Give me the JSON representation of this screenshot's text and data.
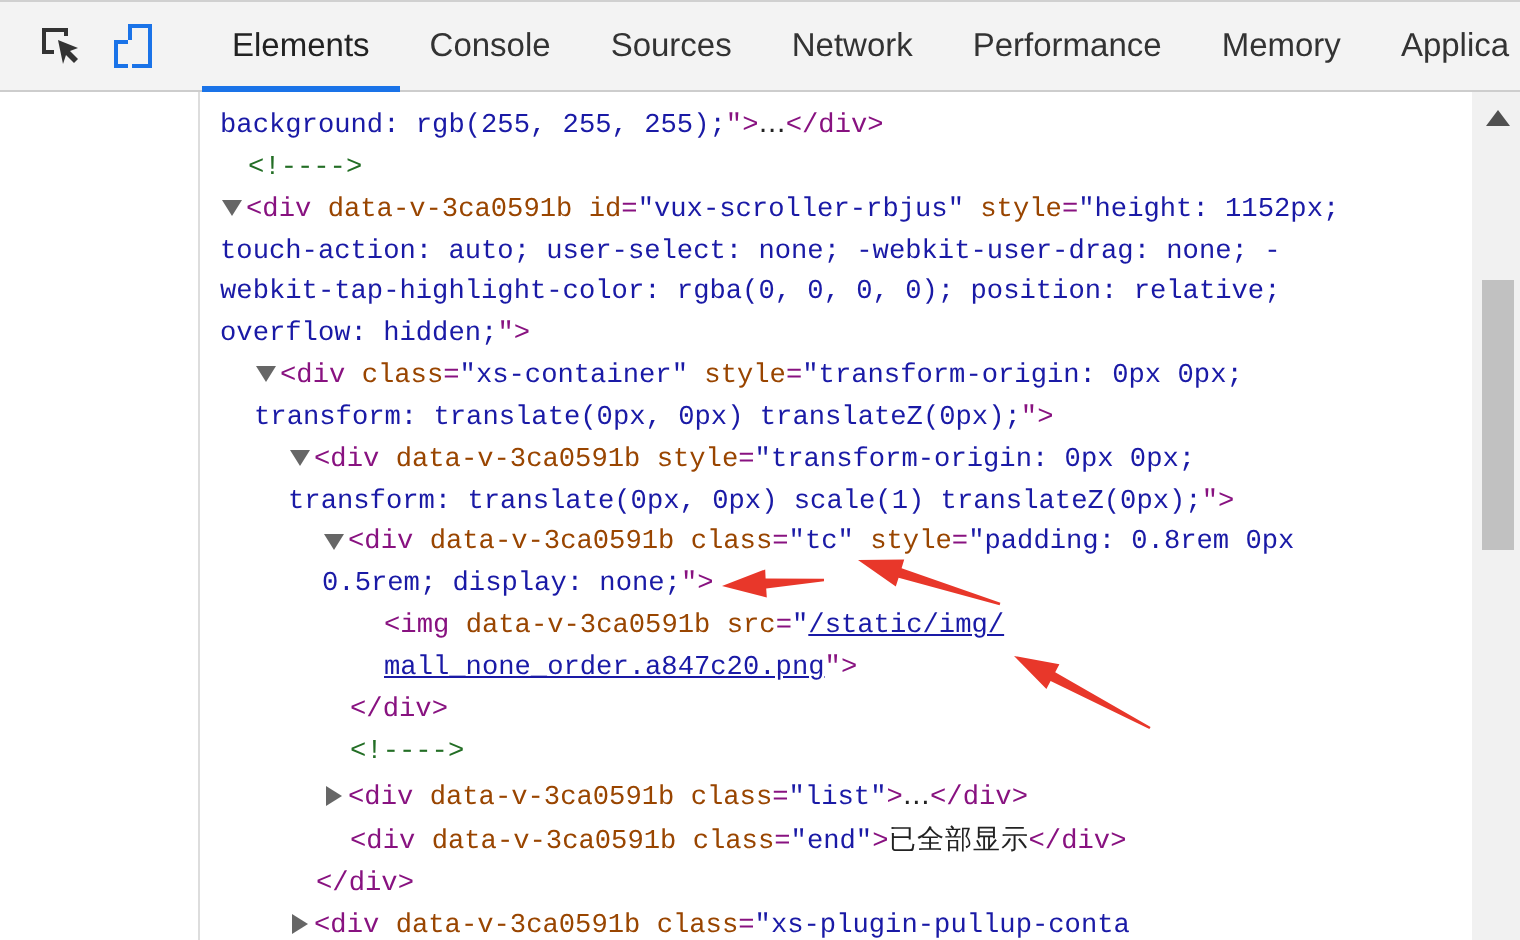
{
  "toolbar": {
    "tabs": [
      {
        "label": "Elements",
        "selected": true
      },
      {
        "label": "Console",
        "selected": false
      },
      {
        "label": "Sources",
        "selected": false
      },
      {
        "label": "Network",
        "selected": false
      },
      {
        "label": "Performance",
        "selected": false
      },
      {
        "label": "Memory",
        "selected": false
      },
      {
        "label": "Applica",
        "selected": false
      }
    ]
  },
  "dom_tree": [
    {
      "kind": "fragment",
      "lines": [
        [
          "background: rgb(255, 255, 255);\">…</div>"
        ]
      ]
    },
    {
      "kind": "leaf",
      "lines": [
        [
          "<!---->"
        ]
      ]
    },
    {
      "kind": "element",
      "expanded": true,
      "lines": [
        [
          "<div data-v-3ca0591b id=\"vux-scroller-rbjus\" style=\"height: 1152px;"
        ],
        [
          "touch-action: auto; user-select: none; -webkit-user-drag: none; -"
        ],
        [
          "webkit-tap-highlight-color: rgba(0, 0, 0, 0); position: relative;"
        ],
        [
          "overflow: hidden;\">"
        ]
      ],
      "children": [
        {
          "kind": "element",
          "expanded": true,
          "lines": [
            [
              "<div class=\"xs-container\" style=\"transform-origin: 0px 0px;"
            ],
            [
              "transform: translate(0px, 0px) translateZ(0px);\">"
            ]
          ],
          "children": [
            {
              "kind": "element",
              "expanded": true,
              "lines": [
                [
                  "<div data-v-3ca0591b style=\"transform-origin: 0px 0px;"
                ],
                [
                  "transform: translate(0px, 0px) scale(1) translateZ(0px);\">"
                ]
              ],
              "children": [
                {
                  "kind": "element",
                  "expanded": true,
                  "lines": [
                    [
                      "<div data-v-3ca0591b class=\"tc\" style=\"padding: 0.8rem 0px"
                    ],
                    [
                      "0.5rem; display: none;\">"
                    ]
                  ],
                  "children": [
                    {
                      "kind": "leaf",
                      "lines": [
                        [
                          "<img data-v-3ca0591b src=\"",
                          {
                            "link": "/static/img/"
                          }
                        ],
                        [
                          {
                            "link": "mall_none_order.a847c20.png"
                          },
                          "\">"
                        ]
                      ]
                    }
                  ],
                  "closing": "</div>"
                },
                {
                  "kind": "leaf",
                  "lines": [
                    [
                      "<!---->"
                    ]
                  ]
                },
                {
                  "kind": "element",
                  "expanded": false,
                  "lines": [
                    [
                      "<div data-v-3ca0591b class=\"list\">…</div>"
                    ]
                  ]
                },
                {
                  "kind": "leaf",
                  "lines": [
                    [
                      "<div data-v-3ca0591b class=\"end\">已全部显示</div>"
                    ]
                  ]
                }
              ],
              "closing": "</div>"
            },
            {
              "kind": "element",
              "expanded": false,
              "lines": [
                [
                  "<div data-v-3ca0591b class=\"xs-plugin-pullup-conta"
                ]
              ]
            }
          ]
        }
      ]
    }
  ]
}
